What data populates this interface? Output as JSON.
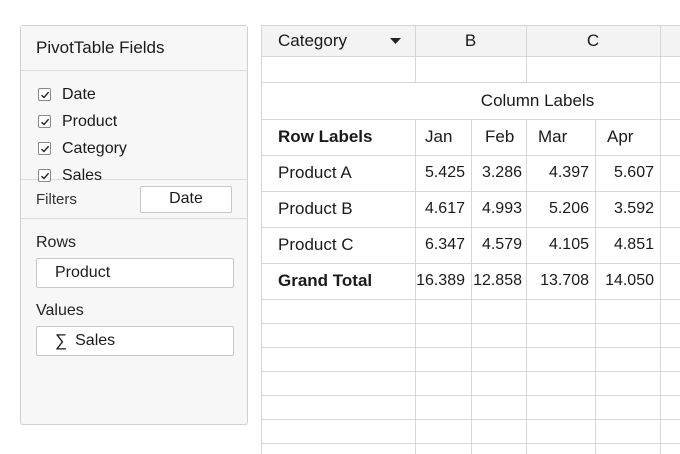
{
  "panel": {
    "title": "PivotTable Fields",
    "fields": [
      {
        "label": "Date",
        "checked": true
      },
      {
        "label": "Product",
        "checked": true
      },
      {
        "label": "Category",
        "checked": true
      },
      {
        "label": "Sales",
        "checked": true
      }
    ],
    "filters_label": "Filters",
    "filters_value": "Date",
    "rows_label": "Rows",
    "rows_value": "Product",
    "values_label": "Values",
    "values_icon": "sigma-icon",
    "values_value": "Sales"
  },
  "sheet": {
    "header_row": {
      "a": "Category",
      "b": "B",
      "c": "C"
    },
    "column_labels": "Column Labels",
    "row_labels_header": "Row Labels",
    "months": [
      "Jan",
      "Feb",
      "Mar",
      "Apr"
    ],
    "rows": [
      {
        "label": "Product A",
        "values": [
          "5.425",
          "3.286",
          "4.397",
          "5.607"
        ]
      },
      {
        "label": "Product B",
        "values": [
          "4.617",
          "4.993",
          "5.206",
          "3.592"
        ]
      },
      {
        "label": "Product C",
        "values": [
          "6.347",
          "4.579",
          "4.105",
          "4.851"
        ]
      }
    ],
    "grand_total": {
      "label": "Grand Total",
      "values": [
        "16.389",
        "12.858",
        "13.708",
        "14.050"
      ]
    }
  },
  "colors": {
    "border": "#d6d6d6",
    "panel_bg": "#f7f7f7",
    "header_bg": "#f3f3f3"
  }
}
